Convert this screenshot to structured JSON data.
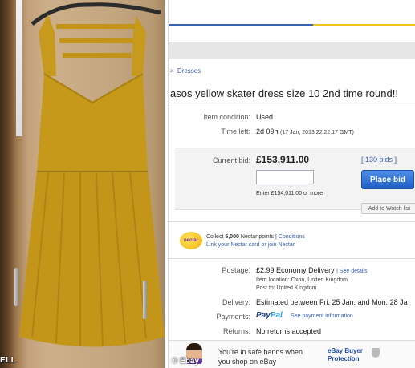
{
  "photo": {
    "credit": "ELL"
  },
  "listing": {
    "breadcrumb": "Dresses",
    "title": "asos yellow skater dress size 10 2nd time round!!",
    "condition_label": "Item condition:",
    "condition_value": "Used",
    "time_left_label": "Time left:",
    "time_left_value": "2d 09h",
    "time_left_detail": "(17 Jan, 2013  22:22:17 GMT)",
    "current_bid_label": "Current bid:",
    "current_bid_value": "£153,911.00",
    "bid_count": "[ 130 bids ]",
    "place_bid_label": "Place bid",
    "enter_hint": "Enter £154,011.00 or more",
    "watch_label": "Add to Watch list",
    "nectar_logo": "nectar",
    "nectar_line1_a": "Collect ",
    "nectar_line1_b": "5,000",
    "nectar_line1_c": " Nectar points | ",
    "nectar_conditions": "Conditions",
    "nectar_line2": "Link your Nectar card or join Nectar",
    "postage_label": "Postage:",
    "postage_value": "£2.99",
    "postage_type": "Economy Delivery",
    "postage_link": "| See details",
    "item_location": "Item location:  Oxon, United Kingdom",
    "post_to": "Post to:   United Kingdom",
    "delivery_label": "Delivery:",
    "delivery_value": "Estimated between Fri. 25 Jan. and Mon. 28 Ja",
    "payments_label": "Payments:",
    "paypal_a": "Pay",
    "paypal_b": "Pal",
    "payment_link": "See payment information",
    "returns_label": "Returns:",
    "returns_value": "No returns accepted",
    "safe_line1": "You're in safe hands when",
    "safe_line2": "you shop on eBay",
    "ebp_line1": "eBay Buyer",
    "ebp_line2": "Protection",
    "credit": "© Ebay"
  }
}
